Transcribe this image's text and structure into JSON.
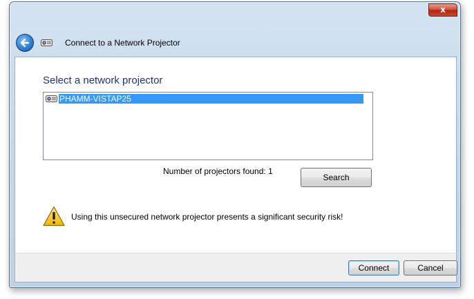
{
  "window": {
    "title": "Connect to a Network Projector",
    "close_glyph": "x"
  },
  "main": {
    "heading": "Select a network projector",
    "projectors": [
      {
        "name": "PHAMM-VISTAP25",
        "icon": "projector-icon",
        "selected": true
      }
    ],
    "count_text": "Number of projectors found: 1",
    "search_label": "Search",
    "warning_text": "Using this unsecured network projector presents a significant security risk!"
  },
  "footer": {
    "connect_label": "Connect",
    "cancel_label": "Cancel"
  },
  "colors": {
    "heading": "#1e3287",
    "selection": "#3399ff",
    "close_button": "#c24a2e"
  }
}
